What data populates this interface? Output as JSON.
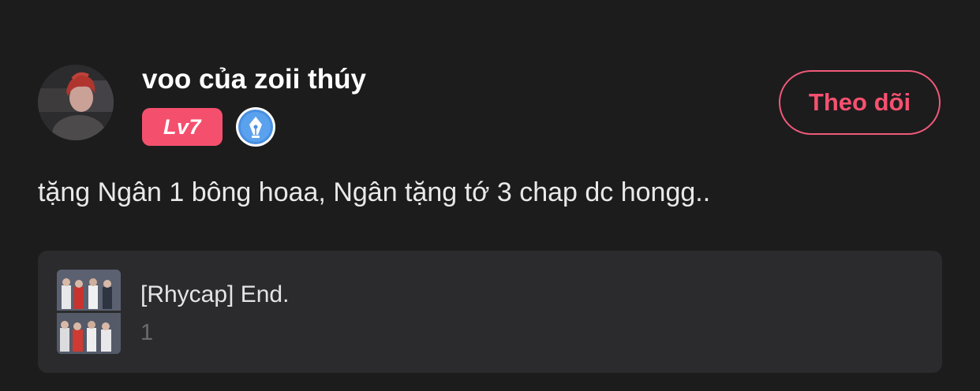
{
  "post": {
    "author": {
      "name": "voo của zoii thúy",
      "level": "Lv7",
      "badge_icon": "pen-nib-icon"
    },
    "follow_label": "Theo dõi",
    "content": "tặng Ngân 1 bông hoaa, Ngân tặng tớ 3 chap dc hongg..",
    "attachment": {
      "title": "[Rhycap] End.",
      "count": "1"
    }
  },
  "colors": {
    "background": "#1c1c1d",
    "accent": "#f4506e",
    "card": "#2b2b2d",
    "badge_blue": "#4a8fe0"
  }
}
